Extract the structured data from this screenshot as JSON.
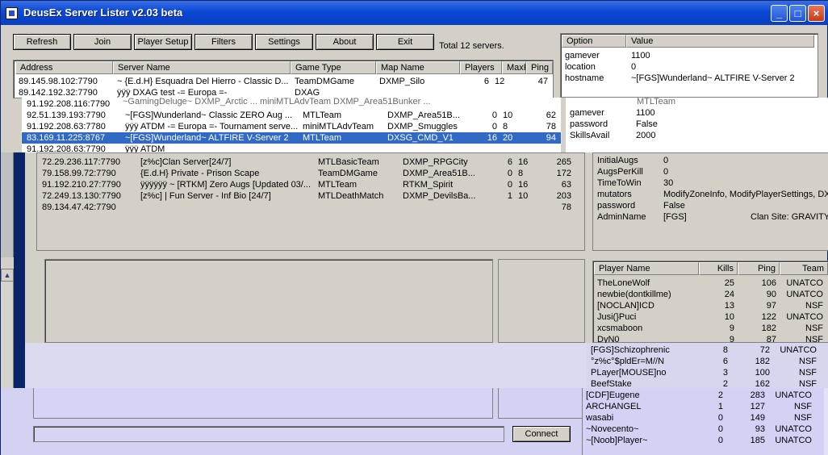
{
  "window": {
    "title": "DeusEx Server Lister v2.03 beta"
  },
  "toolbar": {
    "refresh": "Refresh",
    "join": "Join",
    "player_setup": "Player Setup",
    "filters": "Filters",
    "settings": "Settings",
    "about": "About",
    "exit": "Exit"
  },
  "total": "Total 12 servers.",
  "server_headers": {
    "address": "Address",
    "name": "Server Name",
    "type": "Game Type",
    "map": "Map Name",
    "players": "Players",
    "max": "MaxP.",
    "ping": "Ping"
  },
  "servers_top": [
    {
      "address": "89.145.98.102:7790",
      "name": "~ {E.d.H} Esquadra Del Hierro - Classic D...",
      "type": "TeamDMGame",
      "map": "DXMP_Silo",
      "players": "6",
      "max": "12",
      "ping": "47"
    },
    {
      "address": "89.142.192.32:7790",
      "name": "ÿÿÿ DXAG test -= Europa =-",
      "type": "DXAG",
      "map": "",
      "players": "",
      "max": "",
      "ping": ""
    }
  ],
  "servers_mid": [
    {
      "address": "91.192.208.116:7790",
      "name": "",
      "type": "",
      "map": "",
      "players": "",
      "max": "",
      "ping": "",
      "sel": false
    },
    {
      "address": "92.51.139.193:7790",
      "name": "~[FGS]Wunderland~ Classic ZERO Aug ...",
      "type": "MTLTeam",
      "map": "DXMP_Area51B...",
      "players": "0",
      "max": "10",
      "ping": "62",
      "sel": false
    },
    {
      "address": "91.192.208.63:7780",
      "name": "ÿÿÿ ATDM -= Europa =- Tournament serve...",
      "type": "miniMTLAdvTeam",
      "map": "DXMP_Smuggles",
      "players": "0",
      "max": "8",
      "ping": "78",
      "sel": false
    },
    {
      "address": "83.169.11.225:8767",
      "name": "~[FGS]Wunderland~ ALTFIRE V-Server 2",
      "type": "MTLTeam",
      "map": "DXSG_CMD_V1",
      "players": "16",
      "max": "20",
      "ping": "94",
      "sel": true
    },
    {
      "address": "91.192.208.63:7790",
      "name": "ÿÿÿ ATDM",
      "type": "",
      "map": "",
      "players": "",
      "max": "",
      "ping": "",
      "sel": false
    }
  ],
  "servers_bottom": [
    {
      "address": "72.29.236.117:7790",
      "name": "[z%c]Clan Server[24/7]",
      "type": "MTLBasicTeam",
      "map": "DXMP_RPGCity",
      "players": "6",
      "max": "16",
      "ping": "265"
    },
    {
      "address": "79.158.99.72:7790",
      "name": "{E.d.H} Private - Prison Scape",
      "type": "TeamDMGame",
      "map": "DXMP_Area51B...",
      "players": "0",
      "max": "8",
      "ping": "172"
    },
    {
      "address": "91.192.210.27:7790",
      "name": "ÿÿÿÿÿÿ ~ [RTKM] Zero Augs [Updated 03/...",
      "type": "MTLTeam",
      "map": "RTKM_Spirit",
      "players": "0",
      "max": "16",
      "ping": "63"
    },
    {
      "address": "72.249.13.130:7790",
      "name": "[z%c] | Fun Server - Inf Bio [24/7]",
      "type": "MTLDeathMatch",
      "map": "DXMP_DevilsBa...",
      "players": "1",
      "max": "10",
      "ping": "203"
    },
    {
      "address": "89.134.47.42:7790",
      "name": "",
      "type": "",
      "map": "",
      "players": "",
      "max": "",
      "ping": "78"
    }
  ],
  "option_headers": {
    "option": "Option",
    "value": "Value"
  },
  "options_top": [
    {
      "option": "gamever",
      "value": "1100"
    },
    {
      "option": "location",
      "value": "0"
    },
    {
      "option": "hostname",
      "value": "~[FGS]Wunderland~ ALTFIRE V-Server 2"
    }
  ],
  "options_mid": [
    {
      "option": "gamever",
      "value": "1100"
    },
    {
      "option": "password",
      "value": "False"
    },
    {
      "option": "SkillsAvail",
      "value": "2000"
    }
  ],
  "options_bottom": [
    {
      "option": "InitialAugs",
      "value": "0"
    },
    {
      "option": "AugsPerKill",
      "value": "0"
    },
    {
      "option": "TimeToWin",
      "value": "30"
    },
    {
      "option": "mutators",
      "value": "ModifyZoneInfo, ModifyPlayerSettings, DX..."
    },
    {
      "option": "password",
      "value": "False"
    },
    {
      "option": "AdminName",
      "value": "[FGS]",
      "extra": "Clan Site: GRAVITY-"
    }
  ],
  "player_headers": {
    "name": "Player Name",
    "kills": "Kills",
    "ping": "Ping",
    "team": "Team"
  },
  "players_a": [
    {
      "name": "TheLoneWolf",
      "kills": "25",
      "ping": "106",
      "team": "UNATCO"
    },
    {
      "name": "newbie(dontkillme)",
      "kills": "24",
      "ping": "90",
      "team": "UNATCO"
    },
    {
      "name": "[NOCLAN]ICD",
      "kills": "13",
      "ping": "97",
      "team": "NSF"
    },
    {
      "name": "Jusi(}Puci",
      "kills": "10",
      "ping": "122",
      "team": "UNATCO"
    },
    {
      "name": "xcsmaboon",
      "kills": "9",
      "ping": "182",
      "team": "NSF"
    },
    {
      "name": "DyN0",
      "kills": "9",
      "ping": "87",
      "team": "NSF"
    }
  ],
  "players_b": [
    {
      "name": "[FGS]Schizophrenic",
      "kills": "8",
      "ping": "72",
      "team": "UNATCO"
    },
    {
      "name": "°z%c°$pldEr=M//N",
      "kills": "6",
      "ping": "182",
      "team": "NSF"
    },
    {
      "name": "PLayer[MOUSE]no",
      "kills": "3",
      "ping": "100",
      "team": "NSF"
    },
    {
      "name": "BeefStake",
      "kills": "2",
      "ping": "162",
      "team": "NSF"
    }
  ],
  "players_c": [
    {
      "name": "[CDF]Eugene",
      "kills": "2",
      "ping": "283",
      "team": "UNATCO"
    },
    {
      "name": "ARCHANGEL",
      "kills": "1",
      "ping": "127",
      "team": "NSF"
    },
    {
      "name": "wasabi",
      "kills": "0",
      "ping": "149",
      "team": "NSF"
    },
    {
      "name": "~Novecento~",
      "kills": "0",
      "ping": "93",
      "team": "UNATCO"
    },
    {
      "name": "~[Noob]Player~",
      "kills": "0",
      "ping": "185",
      "team": "UNATCO"
    }
  ],
  "connect": {
    "label": "Connect",
    "input_value": ""
  }
}
